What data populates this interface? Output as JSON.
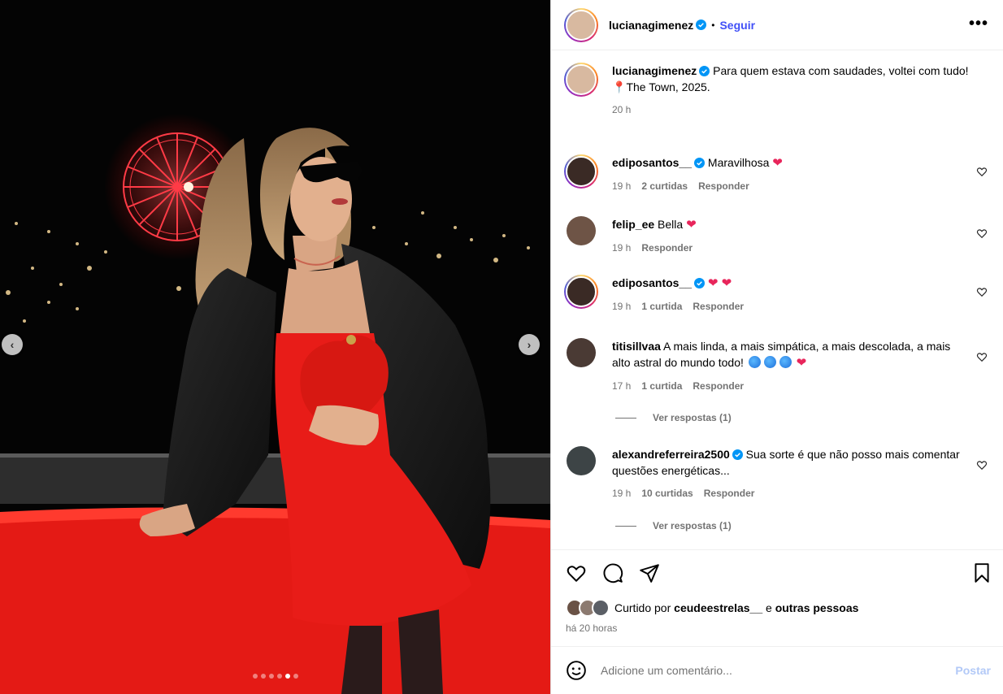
{
  "post": {
    "author": "lucianagimenez",
    "follow_label": "Seguir",
    "separator": "•",
    "more_label": "•••",
    "caption_line1": "Para quem estava com saudades, voltei com tudo!",
    "caption_location": "The Town, 2025.",
    "caption_time": "20 h"
  },
  "comments": [
    {
      "user": "ediposantos__",
      "verified": true,
      "text": "Maravilhosa",
      "emoji": "❤",
      "time": "19 h",
      "likes": "2 curtidas",
      "reply": "Responder"
    },
    {
      "user": "felip_ee",
      "verified": false,
      "text": "Bella",
      "emoji": "❤",
      "time": "19 h",
      "likes": "",
      "reply": "Responder"
    },
    {
      "user": "ediposantos__",
      "verified": true,
      "text": "",
      "emoji": "❤ ❤",
      "time": "19 h",
      "likes": "1 curtida",
      "reply": "Responder"
    },
    {
      "user": "titisillvaa",
      "verified": false,
      "text": "A mais linda, a mais simpática, a mais descolada, a mais alto astral do mundo todo!",
      "emoji": "❤",
      "time": "17 h",
      "likes": "1 curtida",
      "reply": "Responder",
      "view_replies": "Ver respostas (1)"
    },
    {
      "user": "alexandreferreira2500",
      "verified": true,
      "text": "Sua sorte é que não posso mais comentar questões energéticas...",
      "emoji": "",
      "time": "19 h",
      "likes": "10 curtidas",
      "reply": "Responder",
      "view_replies": "Ver respostas (1)"
    }
  ],
  "likes": {
    "prefix": "Curtido por",
    "user": "ceudeestrelas__",
    "connector": "e",
    "others": "outras pessoas",
    "time_ago": "há 20 horas"
  },
  "composer": {
    "placeholder": "Adicione um comentário...",
    "post_label": "Postar"
  },
  "carousel": {
    "total": 6,
    "active_index": 4
  },
  "colors": {
    "accent": "#4150f7",
    "heart": "#e8255b",
    "post_disabled": "#b2c9f7",
    "verified": "#0095f6"
  }
}
